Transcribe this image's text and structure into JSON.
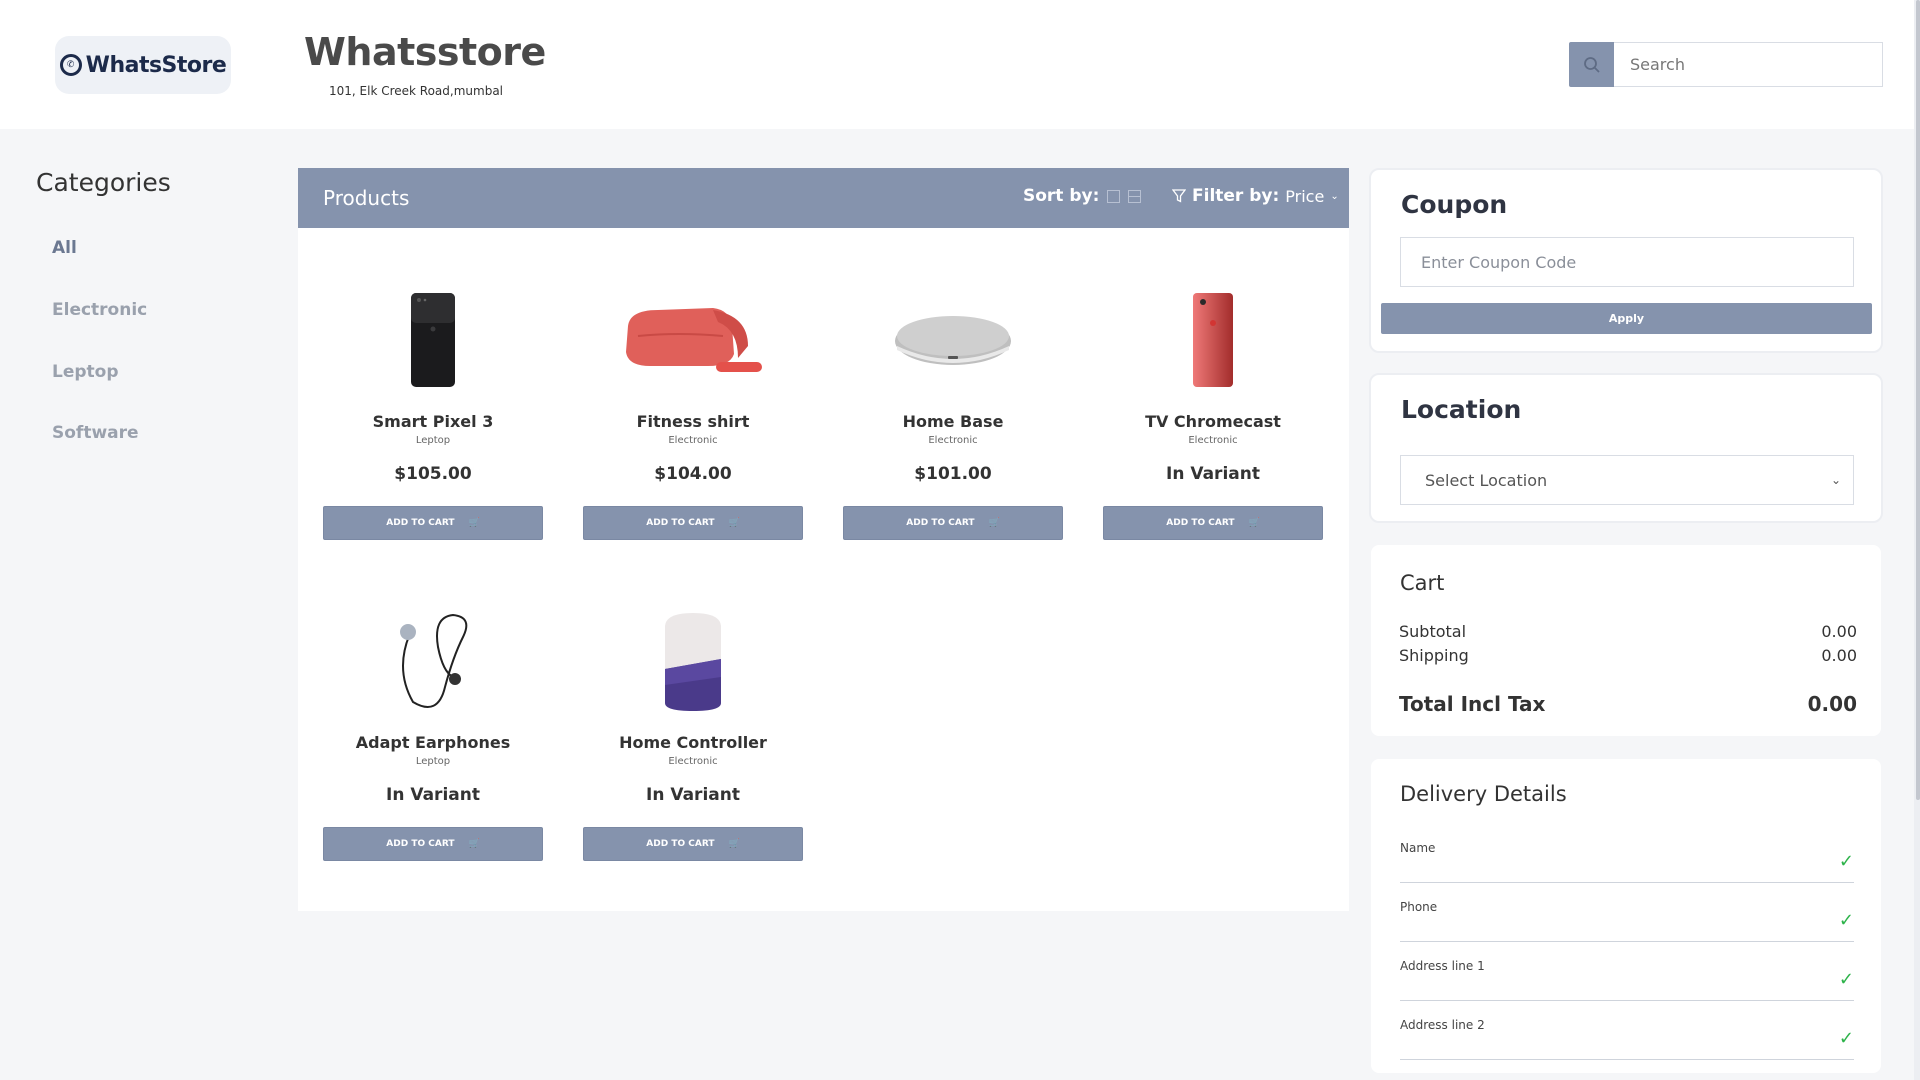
{
  "header": {
    "logo_text": "WhatsStore",
    "store_name": "Whatsstore",
    "address": "101, Elk Creek Road,mumbal",
    "search_placeholder": "Search"
  },
  "categories": {
    "title": "Categories",
    "items": [
      "All",
      "Electronic",
      "Leptop",
      "Software"
    ]
  },
  "products": {
    "title": "Products",
    "sort_label": "Sort by:",
    "filter_label": "Filter by:",
    "filter_value": "Price",
    "button_label": "ADD TO CART",
    "items": [
      {
        "name": "Smart Pixel 3",
        "category": "Leptop",
        "price": "$105.00"
      },
      {
        "name": "Fitness shirt",
        "category": "Electronic",
        "price": "$104.00"
      },
      {
        "name": "Home Base",
        "category": "Electronic",
        "price": "$101.00"
      },
      {
        "name": "TV Chromecast",
        "category": "Electronic",
        "price": "In Variant"
      },
      {
        "name": "Adapt Earphones",
        "category": "Leptop",
        "price": "In Variant"
      },
      {
        "name": "Home Controller",
        "category": "Electronic",
        "price": "In Variant"
      }
    ]
  },
  "coupon": {
    "title": "Coupon",
    "placeholder": "Enter Coupon Code",
    "apply_label": "Apply"
  },
  "location": {
    "title": "Location",
    "selected": "Select Location"
  },
  "cart": {
    "title": "Cart",
    "subtotal_label": "Subtotal",
    "subtotal": "0.00",
    "shipping_label": "Shipping",
    "shipping": "0.00",
    "total_label": "Total Incl Tax",
    "total": "0.00"
  },
  "delivery": {
    "title": "Delivery Details",
    "fields": [
      "Name",
      "Phone",
      "Address line 1",
      "Address line 2"
    ]
  },
  "colors": {
    "accent": "#8593ad",
    "check": "#2db34a"
  }
}
